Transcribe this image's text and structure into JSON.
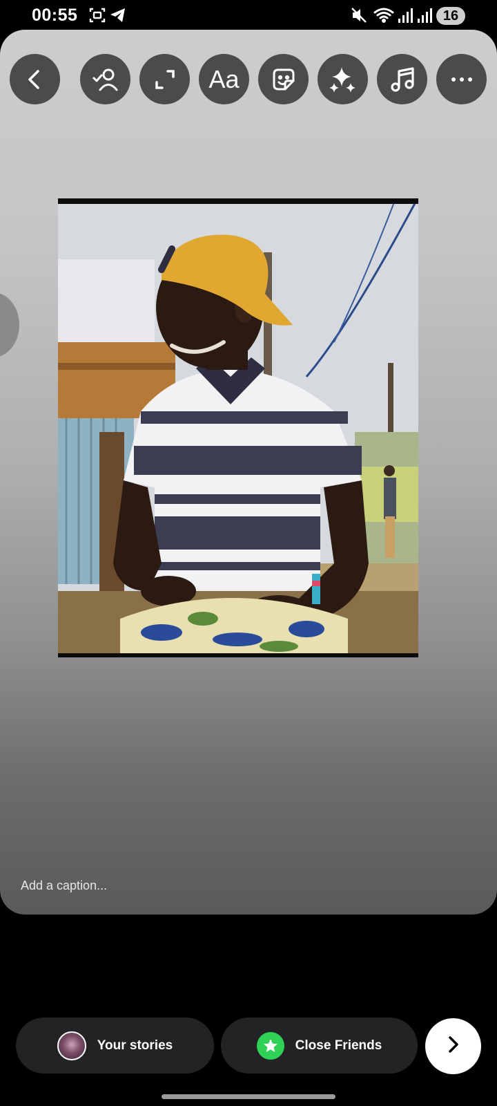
{
  "status_bar": {
    "time": "00:55",
    "battery": "16",
    "icons": [
      "screenshot-icon",
      "telegram-icon",
      "mute-icon",
      "wifi-icon",
      "signal-icon",
      "signal-icon"
    ]
  },
  "toolbar": {
    "tools": [
      {
        "name": "back",
        "icon": "chevron-left-icon"
      },
      {
        "name": "mention",
        "icon": "person-check-icon"
      },
      {
        "name": "resize",
        "icon": "expand-icon"
      },
      {
        "name": "text",
        "icon": "text-icon",
        "label": "Aa"
      },
      {
        "name": "sticker",
        "icon": "sticker-icon"
      },
      {
        "name": "effects",
        "icon": "sparkles-icon"
      },
      {
        "name": "music",
        "icon": "music-note-icon"
      },
      {
        "name": "more",
        "icon": "more-icon"
      }
    ]
  },
  "caption": {
    "placeholder": "Add a caption..."
  },
  "share": {
    "your_stories_label": "Your stories",
    "close_friends_label": "Close Friends",
    "close_friends_color": "#2fd157"
  }
}
